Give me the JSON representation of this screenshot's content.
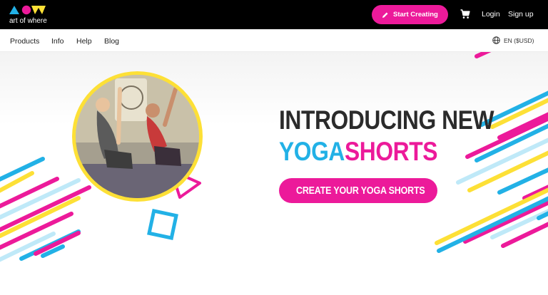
{
  "brand": {
    "name": "art of where"
  },
  "header": {
    "start_button": "Start Creating",
    "login": "Login",
    "signup": "Sign up"
  },
  "nav": {
    "items": [
      "Products",
      "Info",
      "Help",
      "Blog"
    ],
    "language": "EN ($USD)"
  },
  "hero": {
    "line1": "INTRODUCING NEW",
    "word_yoga": "YOGA",
    "word_shorts": "SHORTS",
    "cta": "CREATE YOUR YOGA SHORTS"
  },
  "colors": {
    "pink": "#ec1a9a",
    "blue": "#22b1e6",
    "yellow": "#fde036",
    "dark": "#2b2b2b"
  },
  "icons": [
    "pencil-icon",
    "cart-icon",
    "globe-icon"
  ]
}
